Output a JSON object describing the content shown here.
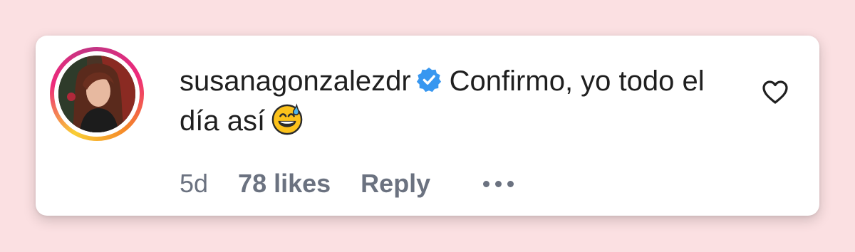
{
  "comment": {
    "avatar_icon": "profile-photo",
    "username": "susanagonzalezdr",
    "verified_icon": "verified-badge-icon",
    "text": "Confirmo, yo todo el día así",
    "emoji_icon": "grinning-face-with-sweat-emoji",
    "timestamp": "5d",
    "likes_label": "78 likes",
    "reply_label": "Reply",
    "more_icon": "more-options-icon",
    "like_icon": "heart-outline-icon"
  },
  "colors": {
    "background": "#fbe0e2",
    "card": "#ffffff",
    "text": "#1f1f1f",
    "muted": "#6b7280",
    "verified": "#3897f0"
  }
}
